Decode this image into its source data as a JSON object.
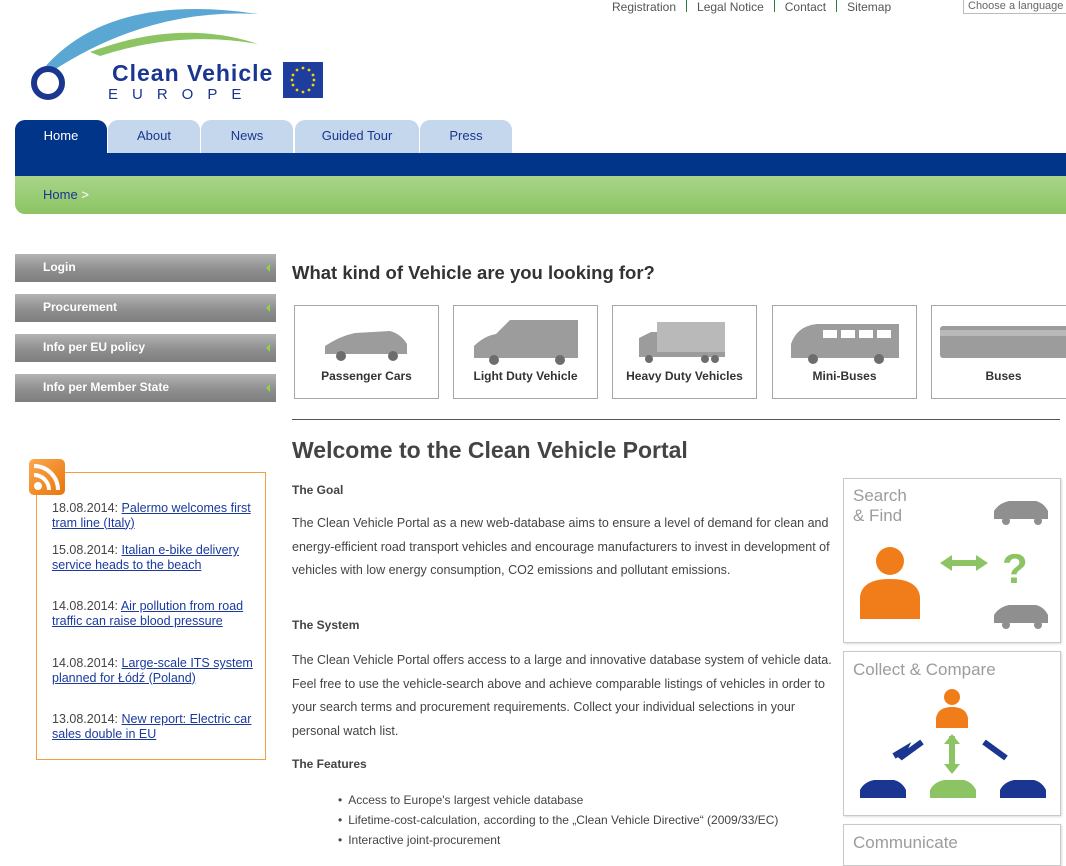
{
  "top_links": [
    "Registration",
    "Legal Notice",
    "Contact",
    "Sitemap"
  ],
  "language_select": "Choose a language",
  "logo": {
    "name": "Clean Vehicle",
    "sub": "EUROPE"
  },
  "tabs": [
    "Home",
    "About",
    "News",
    "Guided Tour",
    "Press"
  ],
  "breadcrumb": {
    "home": "Home",
    "sep": ">"
  },
  "side_nav": [
    "Login",
    "Procurement",
    "Info per EU policy",
    "Info per Member State"
  ],
  "news": [
    {
      "date": "18.08.2014:",
      "title": "Palermo welcomes first tram line (Italy)"
    },
    {
      "date": "15.08.2014:",
      "title": "Italian e-bike delivery service heads to the beach"
    },
    {
      "date": "14.08.2014:",
      "title": "Air pollution from road traffic can raise blood pressure"
    },
    {
      "date": "14.08.2014:",
      "title": "Large-scale ITS system planned for Łódź (Poland)"
    },
    {
      "date": "13.08.2014:",
      "title": "New report: Electric car sales double in EU"
    }
  ],
  "vehicle_question": "What kind of Vehicle are you looking for?",
  "vehicles": [
    "Passenger Cars",
    "Light Duty Vehicle",
    "Heavy Duty Vehicles",
    "Mini-Buses",
    "Buses"
  ],
  "welcome_title": "Welcome to the Clean Vehicle Portal",
  "sections": {
    "goal_title": "The Goal",
    "goal_text": "The Clean Vehicle Portal as a new web-database aims to ensure a level of demand  for clean and energy-efficient road transport vehicles and encourage manufacturers to invest in development of vehicles with low energy consumption, CO2 emissions and pollutant emissions.",
    "system_title": "The System",
    "system_text": "The Clean Vehicle Portal offers access to a large and innovative database system of vehicle data. Feel free to use the vehicle-search above and achieve comparable listings of vehicles in order to your search terms and procurement requirements. Collect your individual selections in your personal watch list.",
    "features_title": "The Features",
    "features": [
      "Access to Europe's largest vehicle database",
      "Lifetime-cost-calculation, according to the „Clean Vehicle Directive“ (2009/33/EC)",
      "Interactive joint-procurement"
    ]
  },
  "panels": {
    "search_line1": "Search",
    "search_line2": "& Find",
    "collect": "Collect & Compare",
    "communicate": "Communicate"
  },
  "colors": {
    "navy": "#00358a",
    "green": "#8cc464",
    "orange": "#f07d1a",
    "gray": "#8f8f8f"
  }
}
